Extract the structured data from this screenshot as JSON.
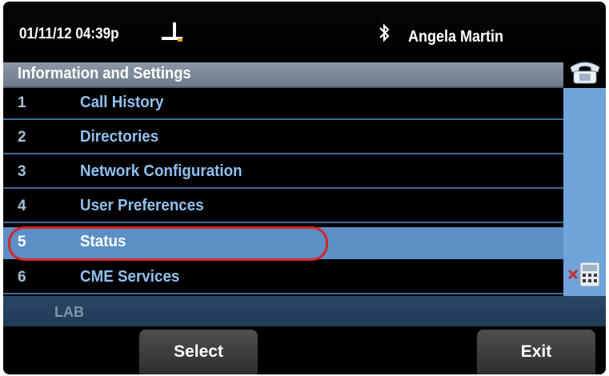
{
  "status_bar": {
    "datetime": "01/11/12 04:39p",
    "user_name": "Angela Martin"
  },
  "menu": {
    "title": "Information and Settings",
    "items": [
      {
        "num": "1",
        "label": "Call History"
      },
      {
        "num": "2",
        "label": "Directories"
      },
      {
        "num": "3",
        "label": "Network Configuration"
      },
      {
        "num": "4",
        "label": "User Preferences"
      },
      {
        "num": "5",
        "label": "Status"
      },
      {
        "num": "6",
        "label": "CME Services"
      }
    ],
    "selected_index": 5
  },
  "lab_label": "LAB",
  "softkeys": {
    "select_label": "Select",
    "exit_label": "Exit"
  },
  "colors": {
    "selected_row": "#5b8fc6",
    "highlight_ring": "#d8242a",
    "item_text": "#8fc0ef"
  }
}
